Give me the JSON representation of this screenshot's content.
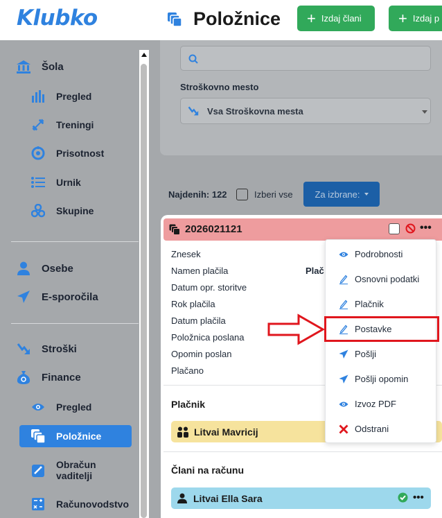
{
  "header": {
    "logo": "Klubko",
    "title": "Položnice",
    "btn_members": "Izdaj člani",
    "btn_payers": "Izdaj p"
  },
  "sidebar": {
    "school": {
      "label": "Šola",
      "items": [
        {
          "label": "Pregled",
          "icon": "bar-chart-icon"
        },
        {
          "label": "Treningi",
          "icon": "dumbbell-icon"
        },
        {
          "label": "Prisotnost",
          "icon": "attendance-icon"
        },
        {
          "label": "Urnik",
          "icon": "list-icon"
        },
        {
          "label": "Skupine",
          "icon": "groups-icon"
        }
      ]
    },
    "persons": "Osebe",
    "email": "E-sporočila",
    "costs": "Stroški",
    "finance": {
      "label": "Finance",
      "items": [
        {
          "label": "Pregled"
        },
        {
          "label": "Položnice"
        },
        {
          "label": "Obračun vaditelji"
        },
        {
          "label": "Računovodstvo"
        }
      ]
    }
  },
  "filters": {
    "cost_center_label": "Stroškovno mesto",
    "cost_center_value": "Vsa Stroškovna mesta"
  },
  "results": {
    "found": "Najdenih: 122",
    "select_all": "Izberi vse",
    "bulk_button": "Za izbrane:"
  },
  "invoice": {
    "number": "2026021121",
    "fields": [
      "Znesek",
      "Namen plačila",
      "Datum opr. storitve",
      "Rok plačila",
      "Datum plačila",
      "Položnica poslana",
      "Opomin poslan",
      "Plačano"
    ],
    "purpose_value_partial": "Plač",
    "payer_title": "Plačnik",
    "payer_name": "Litvai Mavricij",
    "members_title": "Člani na računu",
    "member_name": "Litvai Ella Sara"
  },
  "menu": {
    "items": [
      {
        "label": "Podrobnosti",
        "icon": "eye-icon"
      },
      {
        "label": "Osnovni podatki",
        "icon": "pencil-icon"
      },
      {
        "label": "Plačnik",
        "icon": "pencil-icon"
      },
      {
        "label": "Postavke",
        "icon": "pencil-icon"
      },
      {
        "label": "Pošlji",
        "icon": "send-icon"
      },
      {
        "label": "Pošlji opomin",
        "icon": "send-icon"
      },
      {
        "label": "Izvoz PDF",
        "icon": "eye-icon"
      },
      {
        "label": "Odstrani",
        "icon": "delete-icon"
      }
    ]
  },
  "colors": {
    "accent": "#2f82df",
    "green": "#31a95a",
    "highlight": "#e0161d",
    "invoice_header": "#ee9c9e",
    "payer_bg": "#f6e39d",
    "member_bg": "#9dd8ec"
  }
}
